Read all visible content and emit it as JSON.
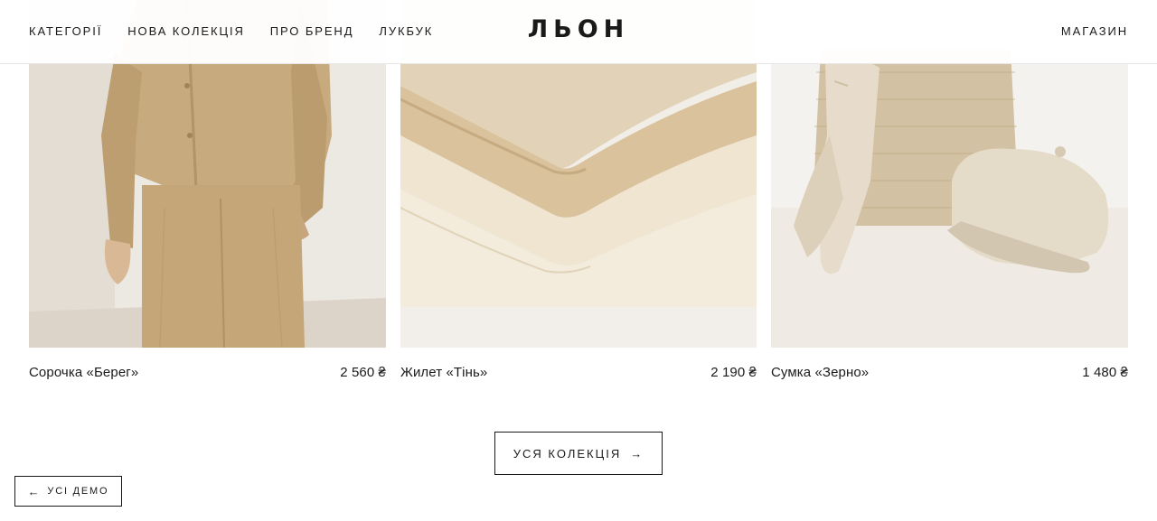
{
  "header": {
    "nav": [
      "КАТЕГОРІЇ",
      "НОВА КОЛЕКЦІЯ",
      "ПРО БРЕНД",
      "ЛУКБУК"
    ],
    "logo": "ЛЬОН",
    "shop": "МАГАЗИН"
  },
  "products": [
    {
      "name": "Сорочка «Берег»",
      "price": "2 560 ₴"
    },
    {
      "name": "Жилет «Тінь»",
      "price": "2 190 ₴"
    },
    {
      "name": "Сумка «Зерно»",
      "price": "1 480 ₴"
    }
  ],
  "all_collection": {
    "label": "УСЯ КОЛЕКЦІЯ",
    "icon": "→"
  },
  "all_demos": {
    "label": "УСІ ДЕМО",
    "icon": "←"
  },
  "colors": {
    "text": "#1a1a1a",
    "linen": "#c9ad82",
    "cream": "#efe5d0",
    "background": "#ffffff"
  }
}
